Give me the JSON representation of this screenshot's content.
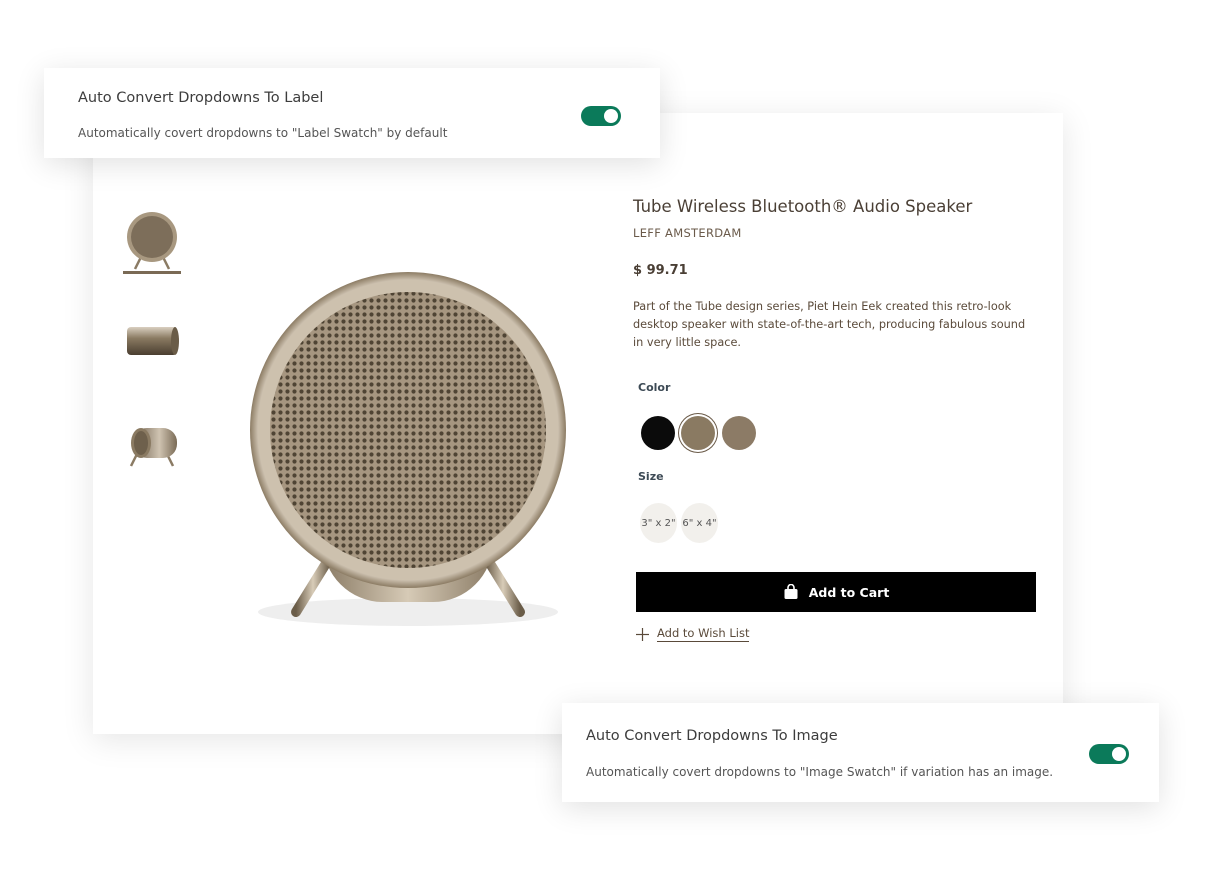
{
  "top_panel": {
    "title": "Auto Convert Dropdowns To Label",
    "description": "Automatically covert dropdowns to \"Label Swatch\" by default",
    "toggle_on": true
  },
  "bottom_panel": {
    "title": "Auto Convert Dropdowns To Image",
    "description": "Automatically covert dropdowns to \"Image Swatch\" if variation has an image.",
    "toggle_on": true
  },
  "product": {
    "title": "Tube Wireless Bluetooth® Audio Speaker",
    "brand": "LEFF AMSTERDAM",
    "price": "$ 99.71",
    "description": "Part of the Tube design series, Piet Hein Eek created this retro-look desktop speaker with state-of-the-art tech, producing fabulous sound in very little space.",
    "color_label": "Color",
    "colors": [
      "#0b0b0b",
      "#8a7a62",
      "#8c7b66"
    ],
    "selected_color_index": 1,
    "size_label": "Size",
    "sizes": [
      "3\" x 2\"",
      "6\" x 4\""
    ],
    "add_to_cart": "Add to Cart",
    "wish_list": "Add to Wish List"
  },
  "colors": {
    "toggle_on": "#0b7a5a",
    "button_bg": "#000000",
    "title_text": "#4a3f35"
  }
}
